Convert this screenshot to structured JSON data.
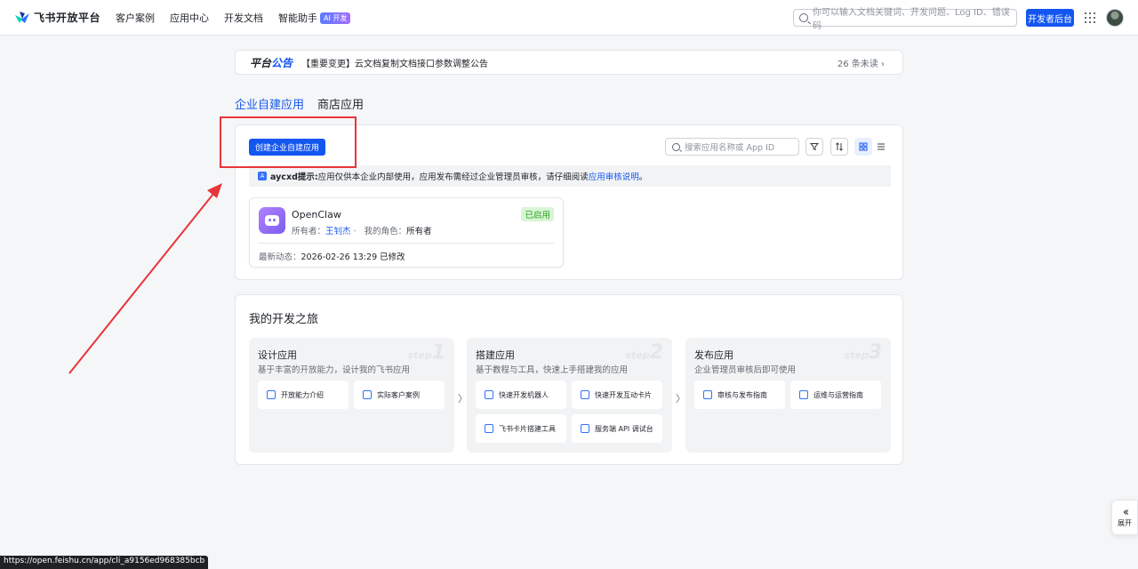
{
  "header": {
    "brand": "飞书开放平台",
    "nav": [
      "客户案例",
      "应用中心",
      "开发文档",
      "智能助手"
    ],
    "ai_badge": "AI 开发",
    "search_placeholder": "你可以输入文档关键词、开发问题、Log ID、错误码",
    "dev_console": "开发者后台"
  },
  "announcement": {
    "label_prefix": "平台",
    "label_suffix": "公告",
    "text": "【重要变更】云文档复制文档接口参数调整公告",
    "unread": "26 条未读"
  },
  "tabs": [
    "企业自建应用",
    "商店应用"
  ],
  "app_panel": {
    "create_button": "创建企业自建应用",
    "search_placeholder": "搜索应用名称或 App ID",
    "tip_user": "aycxd提示:",
    "tip_text": "应用仅供本企业内部使用，应用发布需经过企业管理员审核，请仔细阅读",
    "tip_link": "应用审核说明",
    "tip_end": "。",
    "app": {
      "name": "OpenClaw",
      "status": "已启用",
      "owner_label": "所有者：",
      "owner": "王钊杰",
      "role_label": "我的角色：",
      "role": "所有者",
      "updated_label": "最新动态：",
      "updated": "2026-02-26 13:29 已修改"
    }
  },
  "journey": {
    "title": "我的开发之旅",
    "steps": [
      {
        "title": "设计应用",
        "desc": "基于丰富的开放能力，设计我的飞书应用",
        "wm": "step",
        "num": "1",
        "items": [
          "开放能力介绍",
          "实际客户案例"
        ]
      },
      {
        "title": "搭建应用",
        "desc": "基于教程与工具，快速上手搭建我的应用",
        "wm": "step",
        "num": "2",
        "items": [
          "快速开发机器人",
          "快速开发互动卡片",
          "飞书卡片搭建工具",
          "服务端 API 调试台"
        ]
      },
      {
        "title": "发布应用",
        "desc": "企业管理员审核后即可使用",
        "wm": "step",
        "num": "3",
        "items": [
          "审核与发布指南",
          "运维与运营指南"
        ]
      }
    ]
  },
  "status_url": "https://open.feishu.cn/app/cli_a9156ed968385bcb",
  "expand_label": "展开",
  "colors": {
    "primary": "#1456f0",
    "annotation_red": "#e8353b",
    "success": "#2ea121"
  }
}
